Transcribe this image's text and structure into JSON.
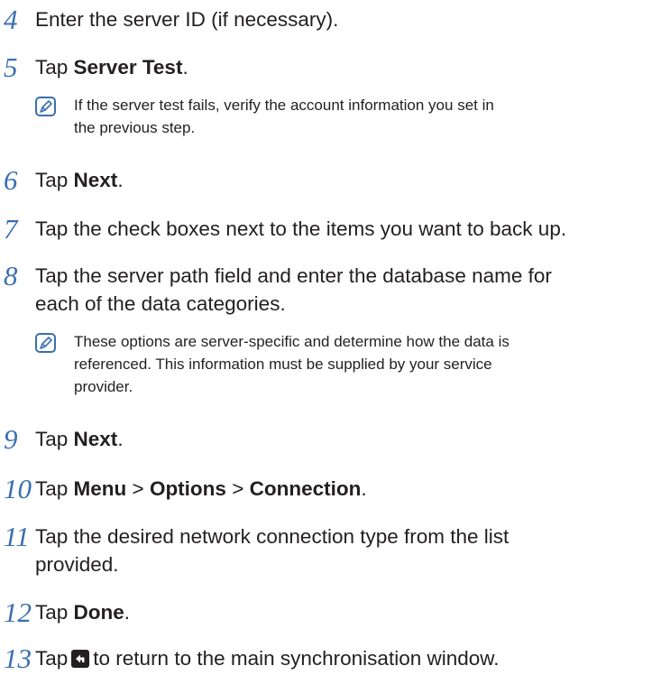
{
  "steps": [
    {
      "num": "4",
      "text": "Enter the server ID (if necessary)."
    },
    {
      "num": "5",
      "pre": "Tap ",
      "b1": "Server Test",
      "post": "."
    },
    {
      "num": "6",
      "pre": "Tap ",
      "b1": "Next",
      "post": "."
    },
    {
      "num": "7",
      "text": "Tap the check boxes next to the items you want to back up."
    },
    {
      "num": "8",
      "line1": "Tap the server path field and enter the database name for",
      "line2": "each of the data categories."
    },
    {
      "num": "9",
      "pre": "Tap ",
      "b1": "Next",
      "post": "."
    },
    {
      "num": "10",
      "pre": "Tap ",
      "b1": "Menu",
      "sep1": " > ",
      "b2": "Options",
      "sep2": " > ",
      "b3": "Connection",
      "post": "."
    },
    {
      "num": "11",
      "line1": "Tap the desired network connection type from the list",
      "line2": "provided."
    },
    {
      "num": "12",
      "pre": "Tap ",
      "b1": "Done",
      "post": "."
    },
    {
      "num": "13",
      "pre": "Tap",
      "post": "to return to the main synchronisation window.",
      "icon": "back-arrow-icon"
    }
  ],
  "notes": [
    {
      "line1": "If the server test fails, verify the account information you set in",
      "line2": "the previous step."
    },
    {
      "line1": "These options are server-specific and determine how the data is",
      "line2": "referenced. This information must be supplied by your service",
      "line3": "provider."
    }
  ],
  "colors": {
    "step_number": "#3a6fb0",
    "text": "#231f20",
    "note_icon": "#3a6fb0",
    "back_icon_bg": "#231f20"
  }
}
